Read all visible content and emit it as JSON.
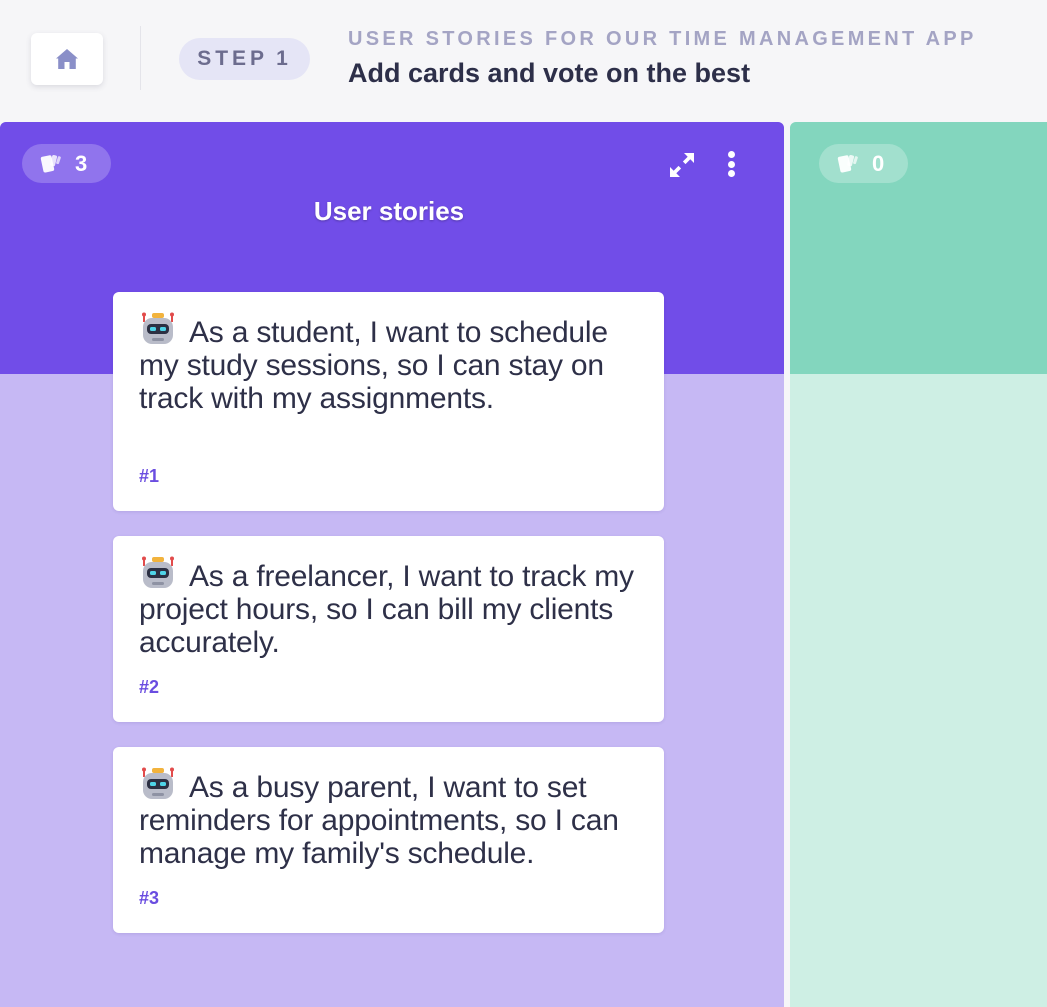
{
  "header": {
    "home_icon": "home-icon",
    "step_word": "STEP",
    "step_number": "1",
    "eyebrow": "USER STORIES FOR OUR TIME MANAGEMENT APP",
    "title": "Add cards and vote on the best"
  },
  "columns": [
    {
      "title": "User stories",
      "card_count": "3",
      "color": "#714de8",
      "background": "#c6b8f4",
      "icons": [
        "cards-icon",
        "expand-icon",
        "more-vertical-icon"
      ],
      "cards": [
        {
          "avatar": "robot-icon",
          "text": "As a student, I want to schedule my study sessions, so I can stay on track with my assignments.",
          "number": "#1"
        },
        {
          "avatar": "robot-icon",
          "text": "As a freelancer, I want to track my project hours, so I can bill my clients accurately.",
          "number": "#2"
        },
        {
          "avatar": "robot-icon",
          "text": "As a busy parent, I want to set reminders for appointments, so I can manage my family's schedule.",
          "number": "#3"
        }
      ]
    },
    {
      "title": "",
      "card_count": "0",
      "color": "#83d6be",
      "background": "#ceefe4",
      "icons": [
        "cards-icon"
      ],
      "cards": []
    }
  ]
}
